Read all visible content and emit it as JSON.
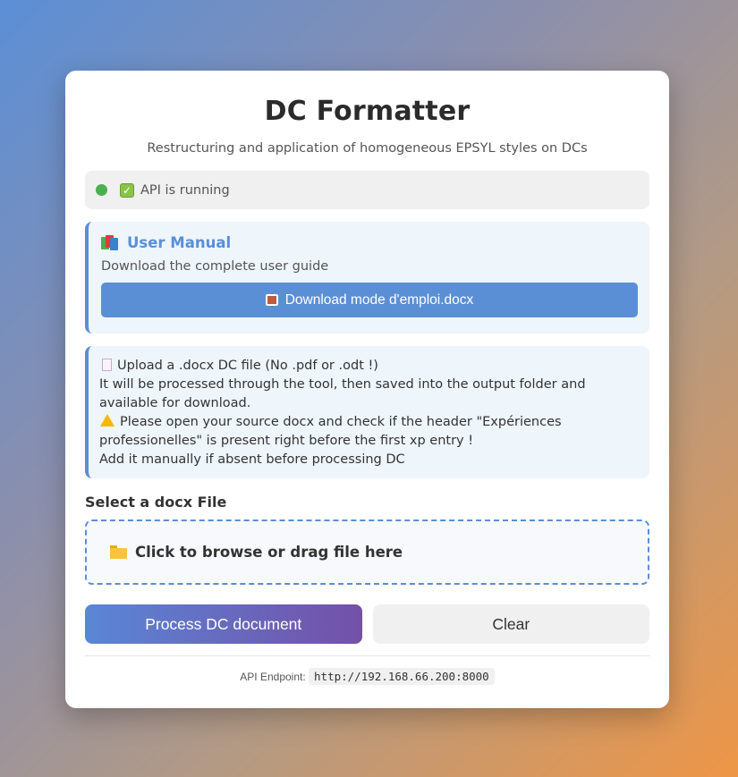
{
  "header": {
    "title": "DC Formatter",
    "subtitle": "Restructuring and application of homogeneous EPSYL styles on DCs"
  },
  "status": {
    "text": "API is running",
    "color": "#4caf50"
  },
  "manual": {
    "title": "User Manual",
    "description": "Download the complete user guide",
    "download_label": "Download mode d'emploi.docx"
  },
  "info": {
    "line1": "Upload a .docx DC file (No .pdf or .odt !)",
    "line2": "It will be processed through the tool, then saved into the output folder and available for download.",
    "line3": "Please open your source docx and check if the header \"Expériences professionelles\" is present right before the first xp entry !",
    "line4": "Add it manually if absent before processing DC"
  },
  "upload": {
    "label": "Select a docx File",
    "dropzone_text": "Click to browse or drag file here"
  },
  "actions": {
    "process_label": "Process DC document",
    "clear_label": "Clear"
  },
  "footer": {
    "endpoint_label": "API Endpoint:",
    "endpoint_value": "http://192.168.66.200:8000"
  },
  "colors": {
    "accent": "#5a8fd6",
    "process_gradient_end": "#7450a8"
  }
}
